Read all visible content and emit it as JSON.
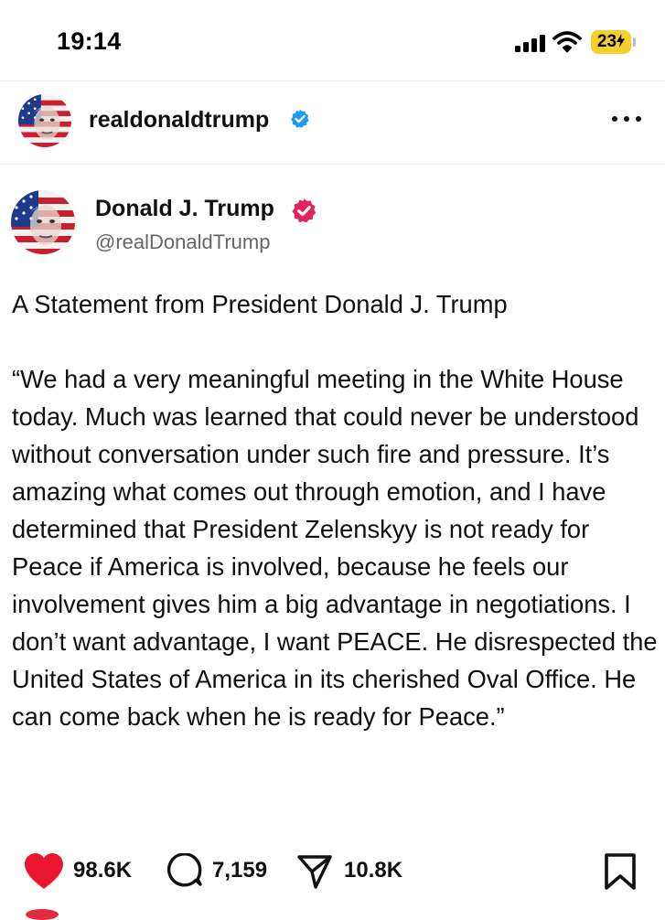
{
  "status_bar": {
    "time": "19:14",
    "battery": "23"
  },
  "account_header": {
    "username": "realdonaldtrump"
  },
  "post": {
    "author": "Donald J. Trump",
    "handle": "@realDonaldTrump",
    "title": "A Statement from President Donald J. Trump",
    "body": "“We had a very meaningful meeting in the White House today. Much was learned that could never be understood without conversation under such fire and pressure. It’s amazing what comes out through emotion, and I have determined that President Zelenskyy is not ready for Peace if America is involved, because he feels our involvement gives him a big advantage in negotiations. I don’t want advantage, I want PEACE. He disrespected the United States of America in its cherished Oval Office. He can come back when he is ready for Peace.”"
  },
  "actions": {
    "likes": "98.6K",
    "replies": "7,159",
    "shares": "10.8K"
  },
  "colors": {
    "like": "#e8172f",
    "verified_blue": "#1d9bf0",
    "verified_pink": "#e0245e",
    "battery": "#f4cf2e"
  },
  "icons": [
    "signal-icon",
    "wifi-icon",
    "battery-icon",
    "verified-badge-icon",
    "more-icon",
    "heart-icon",
    "reply-icon",
    "share-icon",
    "bookmark-icon"
  ]
}
